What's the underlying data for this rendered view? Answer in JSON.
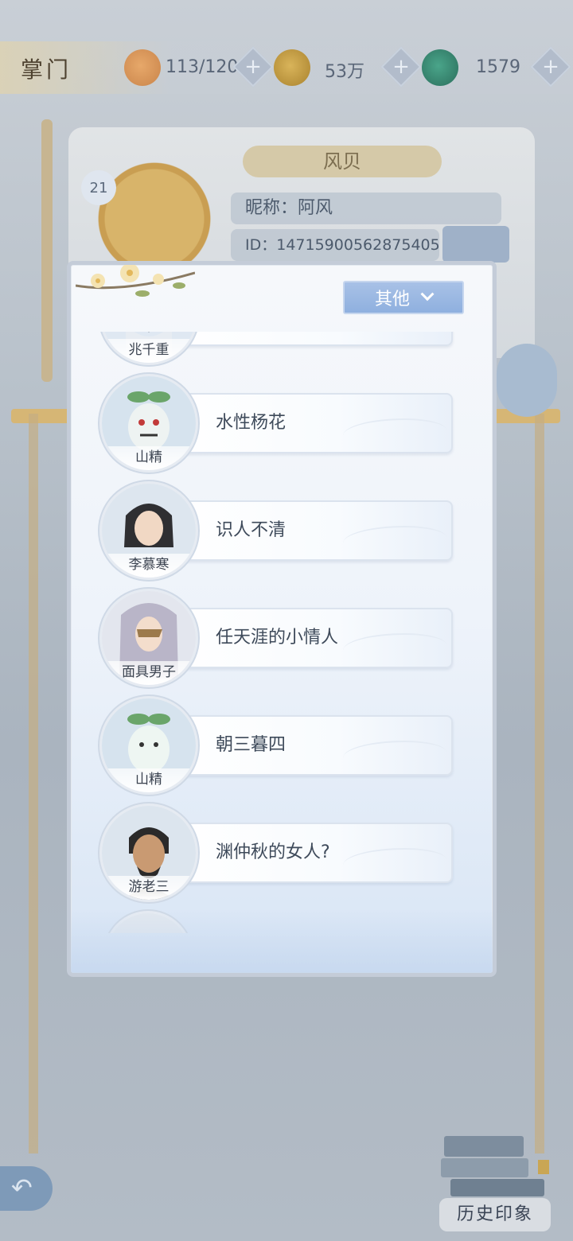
{
  "header": {
    "title": "掌门",
    "resources": [
      {
        "icon": "cat-face-icon",
        "value": "113/120"
      },
      {
        "icon": "gold-coin-icon",
        "value": "53万"
      },
      {
        "icon": "jade-dragon-icon",
        "value": "1579"
      }
    ]
  },
  "profile": {
    "level": "21",
    "name": "风贝",
    "nickname": "昵称：阿风",
    "id": "ID：1471590056287540​51"
  },
  "history_button": {
    "label": "历史印象"
  },
  "modal": {
    "filter": {
      "selected": "其他"
    },
    "items": [
      {
        "name": "兆千重",
        "text": ""
      },
      {
        "name": "山精",
        "text": "水性杨花"
      },
      {
        "name": "李慕寒",
        "text": "识人不清"
      },
      {
        "name": "面具男子",
        "text": "任天涯的小情人"
      },
      {
        "name": "山精",
        "text": "朝三暮四"
      },
      {
        "name": "游老三",
        "text": "渊仲秋的女人?"
      }
    ]
  },
  "colors": {
    "accent_blue": "#98b5e2",
    "panel_bg": "#f3f6fa",
    "text_dark": "#3e4a5a"
  }
}
